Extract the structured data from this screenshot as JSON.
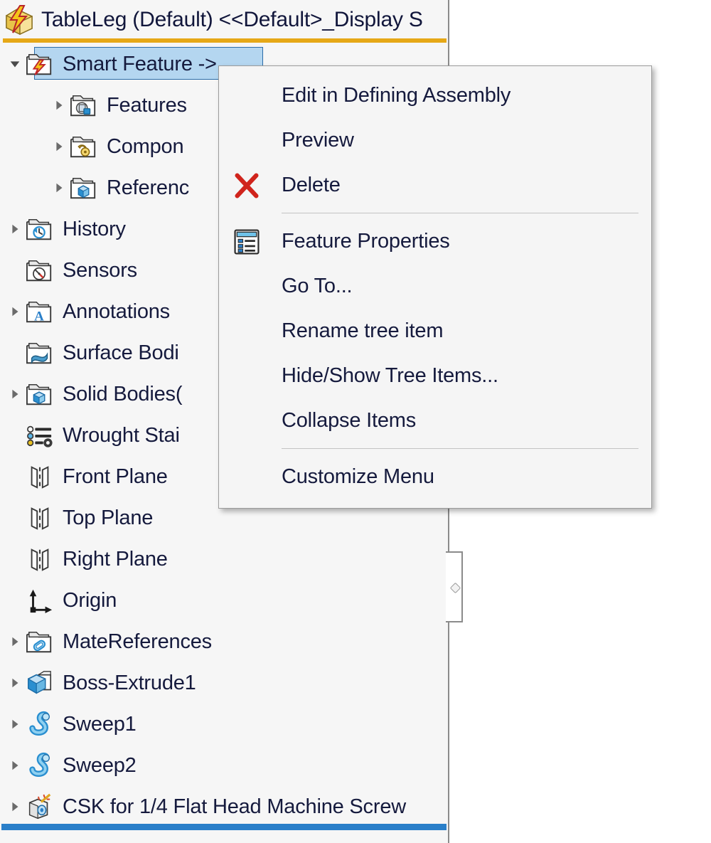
{
  "panel": {
    "title": "TableLeg (Default) <<Default>_Display S",
    "title_icon": "part-with-lightning-icon",
    "accent_underline_color": "#e6a817",
    "background_color": "#f6f6f6",
    "selection_color": "#b4d6f0",
    "rollback_bar_color": "#2a7fc9"
  },
  "tree": {
    "items": [
      {
        "label": "Smart Feature ->",
        "icon": "folder-lightning-icon",
        "indent": 0,
        "arrow": "expanded",
        "selected": true
      },
      {
        "label": "Features",
        "icon": "folder-features-icon",
        "indent": 1,
        "arrow": "collapsed",
        "selected": false
      },
      {
        "label": "Compon",
        "icon": "folder-components-icon",
        "indent": 1,
        "arrow": "collapsed",
        "selected": false
      },
      {
        "label": "Referenc",
        "icon": "folder-references-icon",
        "indent": 1,
        "arrow": "collapsed",
        "selected": false
      },
      {
        "label": "History",
        "icon": "folder-history-icon",
        "indent": 0,
        "arrow": "collapsed",
        "selected": false
      },
      {
        "label": "Sensors",
        "icon": "folder-sensors-icon",
        "indent": 0,
        "arrow": "none",
        "selected": false
      },
      {
        "label": "Annotations",
        "icon": "folder-annotations-icon",
        "indent": 0,
        "arrow": "collapsed",
        "selected": false
      },
      {
        "label": "Surface Bodi",
        "icon": "folder-surface-bodies-icon",
        "indent": 0,
        "arrow": "none",
        "selected": false
      },
      {
        "label": "Solid Bodies(",
        "icon": "folder-solid-bodies-icon",
        "indent": 0,
        "arrow": "collapsed",
        "selected": false
      },
      {
        "label": "Wrought Stai",
        "icon": "material-icon",
        "indent": 0,
        "arrow": "none",
        "selected": false
      },
      {
        "label": "Front Plane",
        "icon": "plane-icon",
        "indent": 0,
        "arrow": "none",
        "selected": false
      },
      {
        "label": "Top Plane",
        "icon": "plane-icon",
        "indent": 0,
        "arrow": "none",
        "selected": false
      },
      {
        "label": "Right Plane",
        "icon": "plane-icon",
        "indent": 0,
        "arrow": "none",
        "selected": false
      },
      {
        "label": "Origin",
        "icon": "origin-icon",
        "indent": 0,
        "arrow": "none",
        "selected": false
      },
      {
        "label": "MateReferences",
        "icon": "folder-matereferences-icon",
        "indent": 0,
        "arrow": "collapsed",
        "selected": false
      },
      {
        "label": "Boss-Extrude1",
        "icon": "boss-extrude-icon",
        "indent": 0,
        "arrow": "collapsed",
        "selected": false
      },
      {
        "label": "Sweep1",
        "icon": "sweep-icon",
        "indent": 0,
        "arrow": "collapsed",
        "selected": false
      },
      {
        "label": "Sweep2",
        "icon": "sweep-icon",
        "indent": 0,
        "arrow": "collapsed",
        "selected": false
      },
      {
        "label": "CSK for 1/4 Flat Head Machine Screw",
        "icon": "hole-wizard-icon",
        "indent": 0,
        "arrow": "collapsed",
        "selected": false
      }
    ]
  },
  "context_menu": {
    "items": [
      {
        "label": "Edit in Defining Assembly",
        "icon": "none",
        "separator_after": false
      },
      {
        "label": "Preview",
        "icon": "none",
        "separator_after": false
      },
      {
        "label": "Delete",
        "icon": "red-x-icon",
        "separator_after": true
      },
      {
        "label": "Feature Properties",
        "icon": "properties-icon",
        "separator_after": false
      },
      {
        "label": "Go To...",
        "icon": "none",
        "separator_after": false
      },
      {
        "label": "Rename tree item",
        "icon": "none",
        "separator_after": false
      },
      {
        "label": "Hide/Show Tree Items...",
        "icon": "none",
        "separator_after": false
      },
      {
        "label": "Collapse Items",
        "icon": "none",
        "separator_after": true
      },
      {
        "label": "Customize Menu",
        "icon": "none",
        "separator_after": false
      }
    ]
  }
}
